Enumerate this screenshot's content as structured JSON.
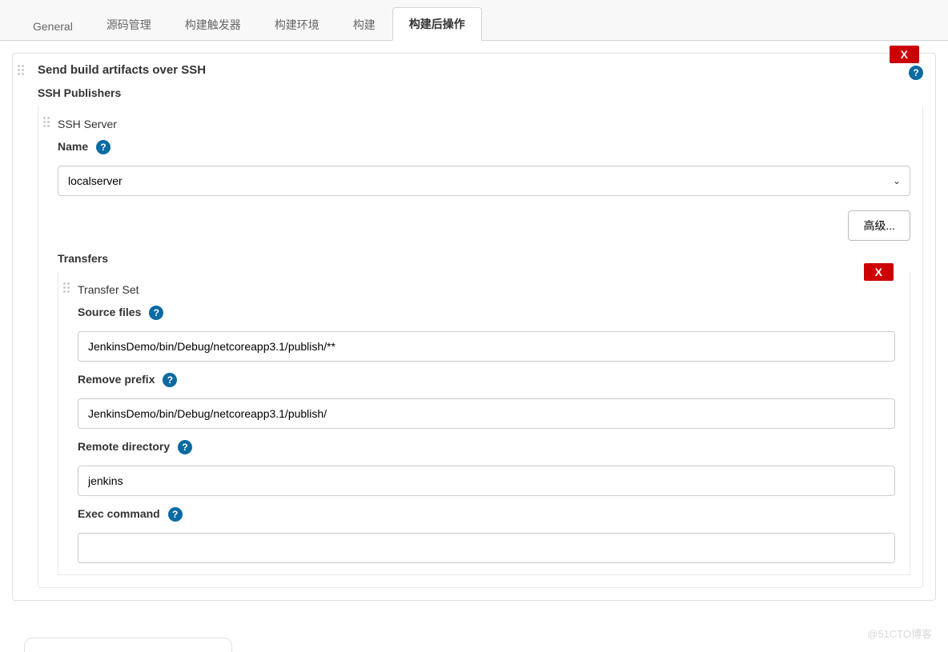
{
  "tabs": {
    "general": "General",
    "scm": "源码管理",
    "triggers": "构建触发器",
    "env": "构建环境",
    "build": "构建",
    "post": "构建后操作"
  },
  "section": {
    "title": "Send build artifacts over SSH",
    "close": "X",
    "publishers_label": "SSH Publishers",
    "server": {
      "title": "SSH Server",
      "name_label": "Name",
      "name_value": "localserver",
      "advanced_btn": "高级..."
    },
    "transfers_label": "Transfers",
    "transfer_set": {
      "title": "Transfer Set",
      "close": "X",
      "source_label": "Source files",
      "source_value": "JenkinsDemo/bin/Debug/netcoreapp3.1/publish/**",
      "remove_prefix_label": "Remove prefix",
      "remove_prefix_value": "JenkinsDemo/bin/Debug/netcoreapp3.1/publish/",
      "remote_dir_label": "Remote directory",
      "remote_dir_value": "jenkins",
      "exec_label": "Exec command"
    }
  },
  "help_glyph": "?",
  "caret_glyph": "⌄",
  "watermark": "@51CTO博客"
}
